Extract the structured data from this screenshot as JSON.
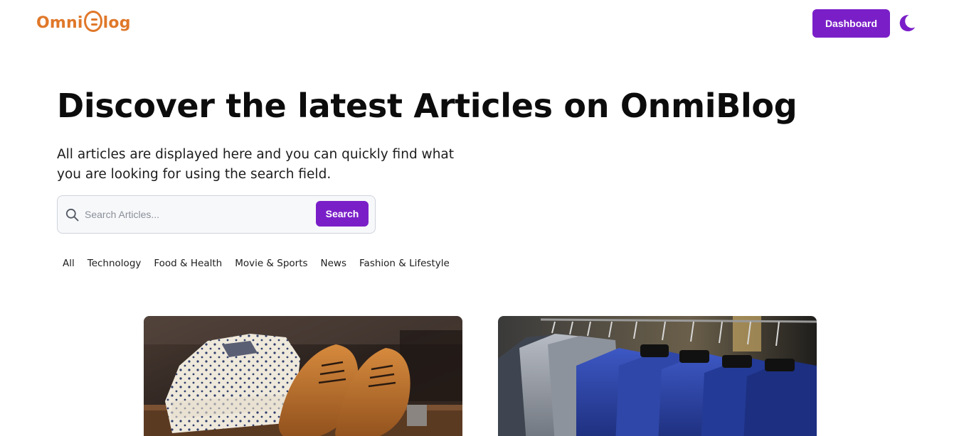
{
  "header": {
    "logo_left": "Omni",
    "logo_right": "log",
    "dashboard_label": "Dashboard",
    "theme_icon": "moon-icon"
  },
  "hero": {
    "title": "Discover the latest Articles on OnmiBlog",
    "subtitle": "All articles are displayed here and you can quickly find what you are looking for using the search field."
  },
  "search": {
    "placeholder": "Search Articles...",
    "value": "",
    "button_label": "Search",
    "icon": "search-icon"
  },
  "categories": [
    "All",
    "Technology",
    "Food & Health",
    "Movie & Sports",
    "News",
    "Fashion & Lifestyle"
  ],
  "articles": [
    {
      "image": "shirts-and-shoes-photo"
    },
    {
      "image": "jackets-on-rack-photo"
    }
  ],
  "colors": {
    "accent": "#7a1fc8",
    "logo": "#e0782a",
    "text": "#0c0c0c"
  }
}
